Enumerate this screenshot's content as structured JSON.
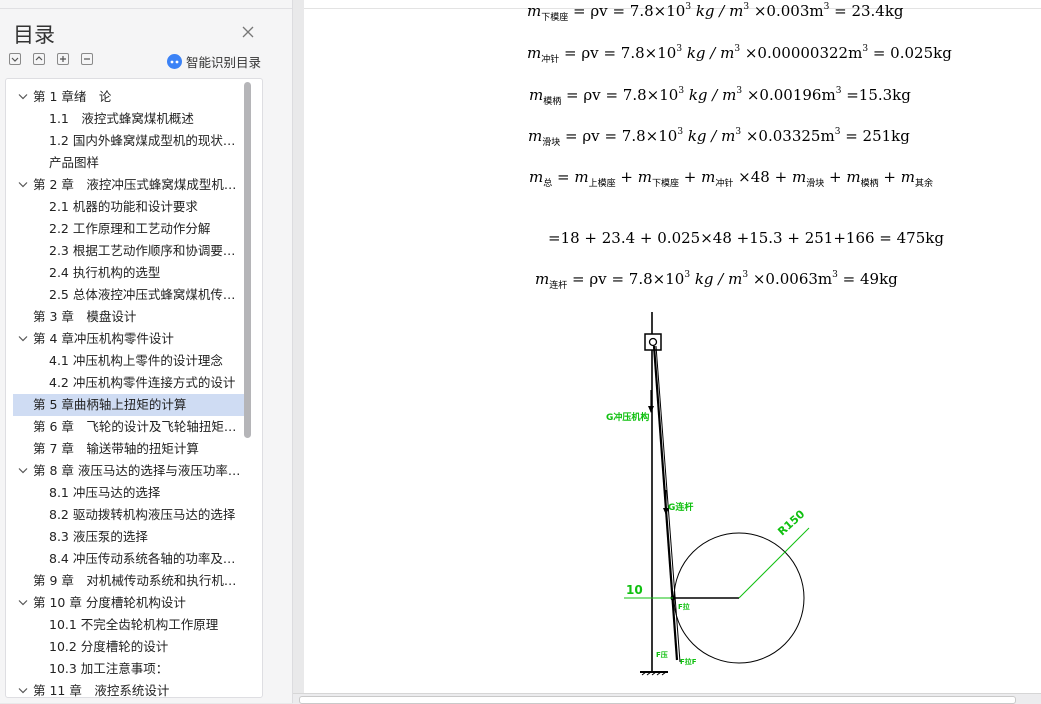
{
  "outline": {
    "title": "目录",
    "smart_label": "智能识别目录",
    "items": [
      {
        "label": "第 1 章绪　论",
        "level": 0,
        "chev": true,
        "selected": false
      },
      {
        "label": "1.1　液控式蜂窝煤机概述",
        "level": 1,
        "chev": false,
        "selected": false
      },
      {
        "label": "1.2 国内外蜂窝煤成型机的现状简介…",
        "level": 1,
        "chev": false,
        "selected": false
      },
      {
        "label": "产品图样",
        "level": 1,
        "chev": false,
        "selected": false
      },
      {
        "label": "第 2 章　液控冲压式蜂窝煤成型机的…",
        "level": 0,
        "chev": true,
        "selected": false
      },
      {
        "label": "2.1 机器的功能和设计要求",
        "level": 1,
        "chev": false,
        "selected": false
      },
      {
        "label": "2.2 工作原理和工艺动作分解",
        "level": 1,
        "chev": false,
        "selected": false
      },
      {
        "label": "2.3 根据工艺动作顺序和协调要求拟…",
        "level": 1,
        "chev": false,
        "selected": false
      },
      {
        "label": "2.4 执行机构的选型",
        "level": 1,
        "chev": false,
        "selected": false
      },
      {
        "label": "2.5 总体液控冲压式蜂窝煤机传动方…",
        "level": 1,
        "chev": false,
        "selected": false
      },
      {
        "label": "第 3 章　模盘设计",
        "level": 0,
        "chev": false,
        "selected": false
      },
      {
        "label": "第 4 章冲压机构零件设计",
        "level": 0,
        "chev": true,
        "selected": false
      },
      {
        "label": "4.1 冲压机构上零件的设计理念",
        "level": 1,
        "chev": false,
        "selected": false
      },
      {
        "label": "4.2 冲压机构零件连接方式的设计",
        "level": 1,
        "chev": false,
        "selected": false
      },
      {
        "label": "第 5 章曲柄轴上扭矩的计算",
        "level": 0,
        "chev": false,
        "selected": true
      },
      {
        "label": "第 6 章　飞轮的设计及飞轮轴扭矩的…",
        "level": 0,
        "chev": false,
        "selected": false
      },
      {
        "label": "第 7 章　输送带轴的扭矩计算",
        "level": 0,
        "chev": false,
        "selected": false
      },
      {
        "label": "第 8 章 液压马达的选择与液压功率的…",
        "level": 0,
        "chev": true,
        "selected": false
      },
      {
        "label": "8.1 冲压马达的选择",
        "level": 1,
        "chev": false,
        "selected": false
      },
      {
        "label": "8.2 驱动拨转机构液压马达的选择",
        "level": 1,
        "chev": false,
        "selected": false
      },
      {
        "label": "8.3 液压泵的选择",
        "level": 1,
        "chev": false,
        "selected": false
      },
      {
        "label": "8.4 冲压传动系统各轴的功率及扭矩…",
        "level": 1,
        "chev": false,
        "selected": false
      },
      {
        "label": "第 9 章　对机械传动系统和执行机构…",
        "level": 0,
        "chev": false,
        "selected": false
      },
      {
        "label": "第 10 章 分度槽轮机构设计",
        "level": 0,
        "chev": true,
        "selected": false
      },
      {
        "label": "10.1 不完全齿轮机构工作原理",
        "level": 1,
        "chev": false,
        "selected": false
      },
      {
        "label": "10.2 分度槽轮的设计",
        "level": 1,
        "chev": false,
        "selected": false
      },
      {
        "label": "10.3 加工注意事项：",
        "level": 1,
        "chev": false,
        "selected": false
      },
      {
        "label": "第 11 章　液控系统设计",
        "level": 0,
        "chev": true,
        "selected": false
      }
    ]
  },
  "doc": {
    "eq_partial": "= 7.8×10",
    "eq_partial_b": "kg / m",
    "eq_partial_c": "×0.003m",
    "eq_partial_d": "= 23.4kg",
    "sub_xiamo": "下模座",
    "sub_chongzhen": "冲针",
    "sub_mobing": "模柄",
    "sub_huakuai": "滑块",
    "sub_zong": "总",
    "sub_shangmo": "上模座",
    "sub_qiyu": "其余",
    "sub_liangan": "连杆",
    "eq2_tail": "= 7.8×10",
    "eq2_b": "kg / m",
    "eq2_c": "×0.00000322m",
    "eq2_d": "= 0.025kg",
    "eq3_c": "×0.00196m",
    "eq3_d": "=15.3kg",
    "eq4_c": "×0.03325m",
    "eq4_d": "= 251kg",
    "eq5_mid": "×48 +",
    "eq6": "=18 + 23.4 + 0.025×48 +15.3 + 251+166 = 475kg",
    "eq7_c": "×0.0063m",
    "eq7_d": "= 49kg",
    "cube": "3",
    "rho_v": "= ρv",
    "m": "m",
    "plus": "+",
    "diagram": {
      "g_link_label": "G冲压机构",
      "g_rod_label": "G连杆",
      "radius_label": "R150",
      "dim_label": "10",
      "f_label_1": "F拉",
      "f_label_2": "F压",
      "f_label_3": "F拉F"
    }
  }
}
